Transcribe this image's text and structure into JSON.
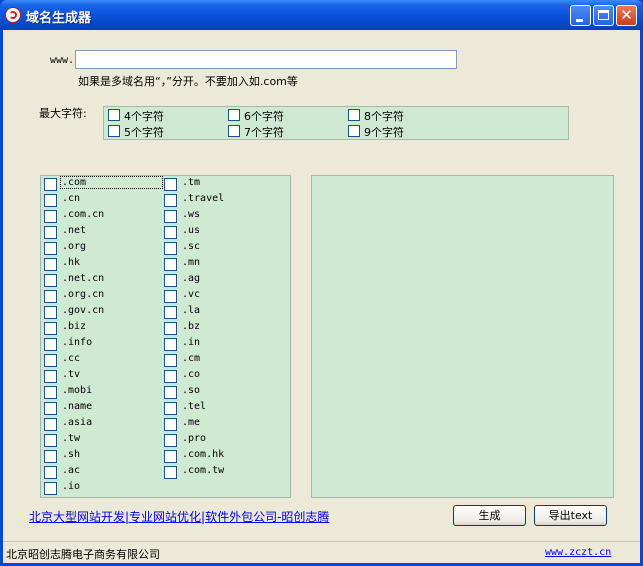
{
  "window": {
    "title": "域名生成器"
  },
  "form": {
    "www_label": "www.",
    "domain_value": "",
    "domain_placeholder": "",
    "hint": "如果是多域名用“，”分开。不要加入如.com等",
    "max_length_label": "最大字符:",
    "length_options": [
      "4个字符",
      "6个字符",
      "8个字符",
      "5个字符",
      "7个字符",
      "9个字符"
    ]
  },
  "domains": {
    "left_column": [
      ".com",
      ".cn",
      ".com.cn",
      ".net",
      ".org",
      ".hk",
      ".net.cn",
      ".org.cn",
      ".gov.cn",
      ".biz",
      ".info",
      ".cc",
      ".tv",
      ".mobi",
      ".name",
      ".asia",
      ".tw",
      ".sh",
      ".ac",
      ".io"
    ],
    "right_column": [
      ".tm",
      ".travel",
      ".ws",
      ".us",
      ".sc",
      ".mn",
      ".ag",
      ".vc",
      ".la",
      ".bz",
      ".in",
      ".cm",
      ".co",
      ".so",
      ".tel",
      ".me",
      ".pro",
      ".com.hk",
      ".com.tw"
    ],
    "focused_item": ".com"
  },
  "footer": {
    "link_text": "北京大型网站开发|专业网站优化|软件外包公司-昭创志腾",
    "generate_button": "生成",
    "export_button": "导出text"
  },
  "statusbar": {
    "company": "北京昭创志腾电子商务有限公司",
    "website": "www.zczt.cn"
  }
}
